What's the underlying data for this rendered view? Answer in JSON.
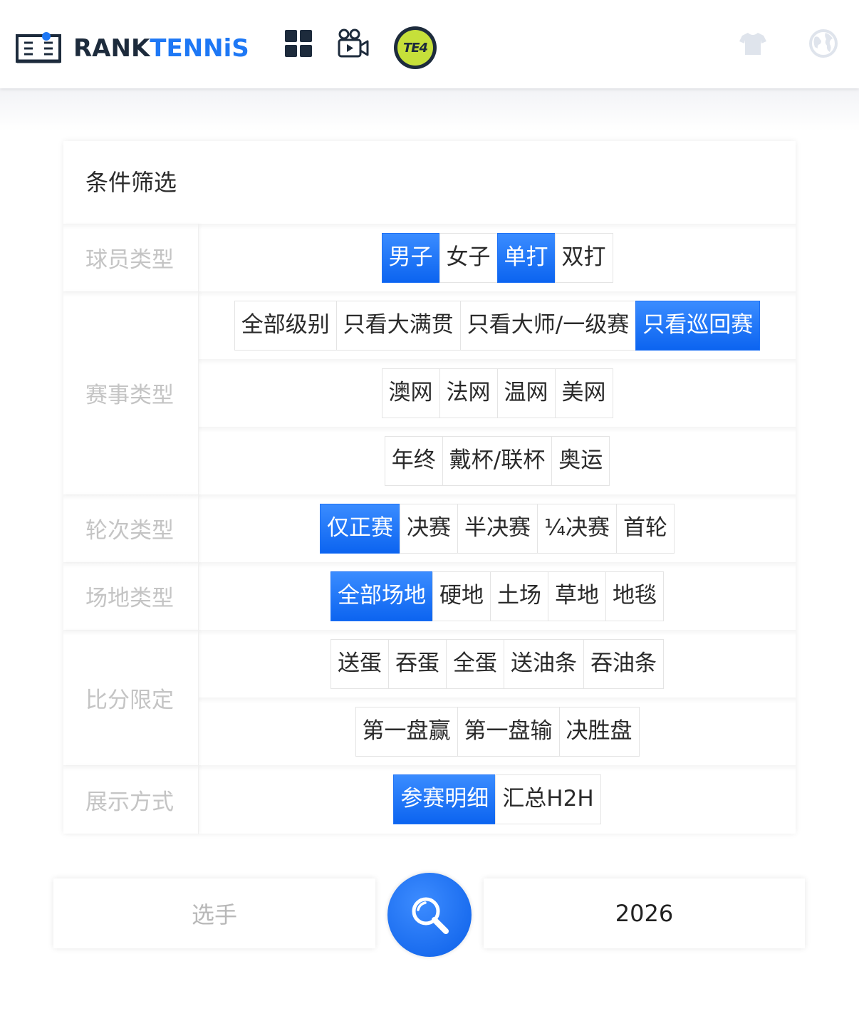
{
  "header": {
    "logo_rank": "RANK",
    "logo_tennis": "TENNiS",
    "badge_text": "TE4",
    "icons": [
      "grid-icon",
      "video-icon",
      "te4-badge-icon",
      "shirt-icon",
      "globe-icon"
    ]
  },
  "filters": {
    "title": "条件筛选",
    "player_type": {
      "label": "球员类型",
      "options": [
        "男子",
        "女子",
        "单打",
        "双打"
      ],
      "active": [
        "男子",
        "单打"
      ]
    },
    "event_type": {
      "label": "赛事类型",
      "row1": [
        "全部级别",
        "只看大满贯",
        "只看大师/一级赛",
        "只看巡回赛"
      ],
      "row1_active": "只看巡回赛",
      "row2": [
        "澳网",
        "法网",
        "温网",
        "美网"
      ],
      "row3": [
        "年终",
        "戴杯/联杯",
        "奥运"
      ]
    },
    "round_type": {
      "label": "轮次类型",
      "options": [
        "仅正赛",
        "决赛",
        "半决赛",
        "¼决赛",
        "首轮"
      ],
      "active": "仅正赛"
    },
    "surface_type": {
      "label": "场地类型",
      "options": [
        "全部场地",
        "硬地",
        "土场",
        "草地",
        "地毯"
      ],
      "active": "全部场地"
    },
    "score_limit": {
      "label": "比分限定",
      "row1": [
        "送蛋",
        "吞蛋",
        "全蛋",
        "送油条",
        "吞油条"
      ],
      "row2": [
        "第一盘赢",
        "第一盘输",
        "决胜盘"
      ]
    },
    "display_mode": {
      "label": "展示方式",
      "options": [
        "参赛明细",
        "汇总H2H"
      ],
      "active": "参赛明细"
    }
  },
  "search": {
    "player_placeholder": "选手",
    "year_value": "2026"
  },
  "colors": {
    "accent": "#1e78f5",
    "logo_dark": "#1d2b3c",
    "label_gray": "#c4c4c4",
    "badge_green": "#c6e03a"
  }
}
